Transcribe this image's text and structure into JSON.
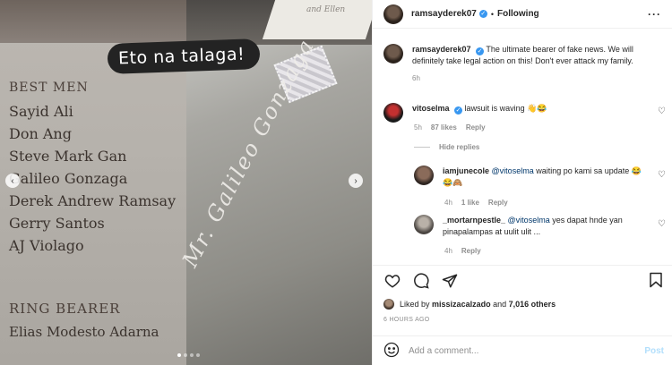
{
  "media": {
    "caption_overlay": "Eto na talaga!",
    "best_men_heading": "BEST MEN",
    "best_men": [
      "Sayid Ali",
      "Don Ang",
      "Steve Mark Gan",
      "Galileo Gonzaga",
      "Derek Andrew Ramsay",
      "Gerry Santos",
      "AJ Violago"
    ],
    "ring_bearer_heading": "RING BEARER",
    "ring_bearer": "Elias Modesto Adarna",
    "envelope_script": "Mr. Galileo Gonzaga",
    "card_corner_text": "and Ellen",
    "carousel_dots": 4,
    "active_dot": 1
  },
  "header": {
    "username": "ramsayderek07",
    "follow_status": "Following",
    "more_icon": "more-horizontal-icon"
  },
  "caption": {
    "username": "ramsayderek07",
    "text": "The ultimate bearer of fake news. We will definitely take legal action on this! Don't ever attack my family.",
    "age": "6h"
  },
  "comments": [
    {
      "username": "vitoselma",
      "text": "lawsuit is waving 👋😂",
      "age": "5h",
      "likes": "87 likes",
      "reply_label": "Reply",
      "hide_replies": "Hide replies",
      "replies": [
        {
          "username": "iamjunecole",
          "mention": "@vitoselma",
          "text": " waiting po kami sa update 😂😂🙈",
          "age": "4h",
          "likes": "1 like",
          "reply_label": "Reply"
        },
        {
          "username": "_mortarnpestle_",
          "mention": "@vitoselma",
          "text": " yes dapat hnde yan pinapalampas at uulit ulit ...",
          "age": "4h",
          "reply_label": "Reply"
        }
      ]
    }
  ],
  "likes": {
    "prefix": "Liked by",
    "user": "missizacalzado",
    "joiner": "and",
    "others": "7,016 others"
  },
  "timestamp": "6 HOURS AGO",
  "add_comment": {
    "placeholder": "Add a comment...",
    "post_label": "Post"
  },
  "colors": {
    "verified": "#3897f0",
    "post_disabled": "#b2dffc",
    "mention": "#00376b"
  }
}
